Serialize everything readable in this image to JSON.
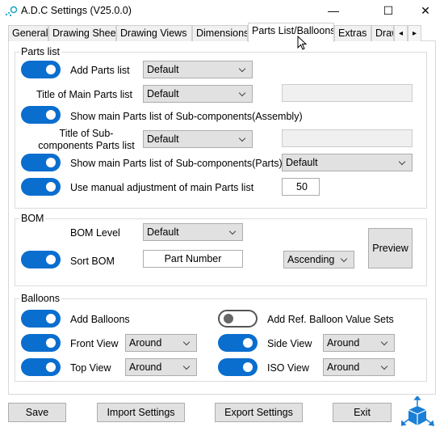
{
  "window": {
    "title": "A.D.C Settings (V25.0.0)",
    "minimize": "—",
    "maximize": "☐",
    "close": "✕"
  },
  "tabs": [
    {
      "label": "General"
    },
    {
      "label": "Drawing Sheet"
    },
    {
      "label": "Drawing Views"
    },
    {
      "label": "Dimensions"
    },
    {
      "label": "Parts List/Balloons",
      "active": true
    },
    {
      "label": "Extras"
    },
    {
      "label": "Draw"
    }
  ],
  "tab_scroll": {
    "left": "◂",
    "right": "▸"
  },
  "parts_list": {
    "title": "Parts list",
    "add_parts_list": {
      "label": "Add Parts list",
      "on": true,
      "value": "Default"
    },
    "title_main": {
      "label": "Title of Main Parts list",
      "value": "Default",
      "text": ""
    },
    "show_assembly": {
      "label": "Show main Parts list of Sub-components(Assembly)",
      "on": true
    },
    "title_sub": {
      "label": "Title of  Sub-components Parts list",
      "value": "Default",
      "text": ""
    },
    "show_parts": {
      "label": "Show main Parts list of Sub-components(Parts)",
      "on": true,
      "value": "Default"
    },
    "manual_adjust": {
      "label": "Use manual adjustment of main Parts list",
      "on": true,
      "value": "50"
    }
  },
  "bom": {
    "title": "BOM",
    "level_label": "BOM Level",
    "level_value": "Default",
    "sort_label": "Sort BOM",
    "sort_on": true,
    "sort_field": "Part Number",
    "sort_order": "Ascending",
    "preview": "Preview"
  },
  "balloons": {
    "title": "Balloons",
    "add_balloons": {
      "label": "Add Balloons",
      "on": true
    },
    "add_ref": {
      "label": "Add Ref. Balloon Value Sets",
      "on": false
    },
    "front": {
      "label": "Front View",
      "on": true,
      "value": "Around"
    },
    "side": {
      "label": "Side View",
      "on": true,
      "value": "Around"
    },
    "top": {
      "label": "Top View",
      "on": true,
      "value": "Around"
    },
    "iso": {
      "label": "ISO View",
      "on": true,
      "value": "Around"
    }
  },
  "footer": {
    "save": "Save",
    "import": "Import Settings",
    "export": "Export Settings",
    "exit": "Exit"
  },
  "colors": {
    "accent": "#0a6ecf",
    "cube": "#1a7fd6"
  }
}
